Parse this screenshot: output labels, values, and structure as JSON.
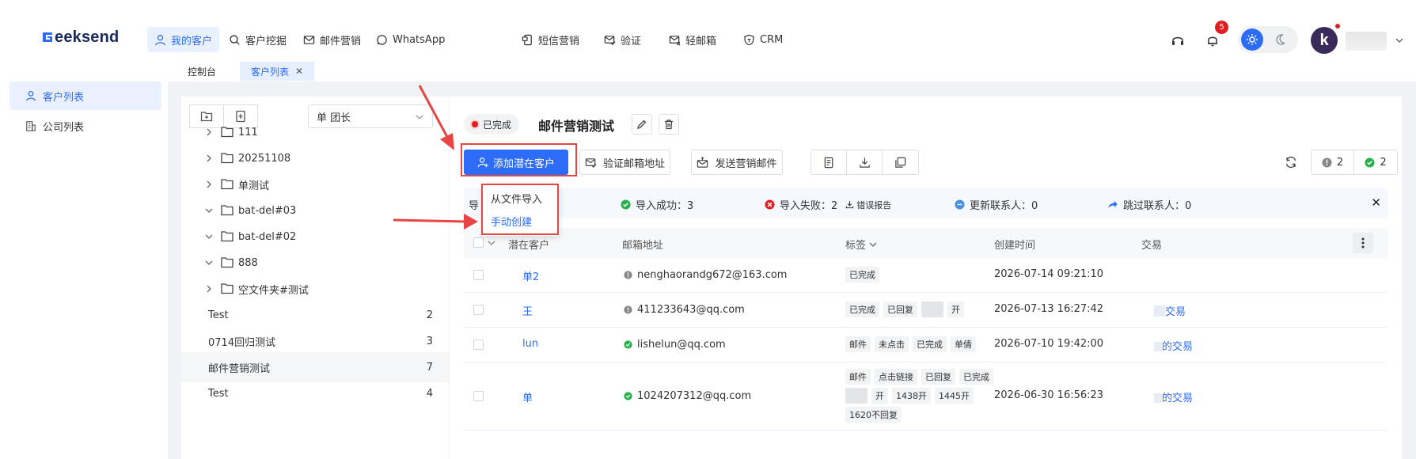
{
  "brand": {
    "logo_rest": "eeksend"
  },
  "nav": {
    "items": [
      {
        "label": "我的客户"
      },
      {
        "label": "客户挖掘"
      },
      {
        "label": "邮件营销"
      },
      {
        "label": "WhatsApp"
      },
      {
        "label": "短信营销"
      },
      {
        "label": "验证"
      },
      {
        "label": "轻邮箱"
      },
      {
        "label": "CRM"
      }
    ],
    "notification_count": "5"
  },
  "tabs": [
    {
      "label": "控制台"
    },
    {
      "label": "客户列表"
    }
  ],
  "sidebar": {
    "items": [
      {
        "label": "客户列表"
      },
      {
        "label": "公司列表"
      }
    ]
  },
  "folders": {
    "select_value": "单 团长",
    "items": [
      {
        "label": "111",
        "count": ""
      },
      {
        "label": "20251108",
        "count": ""
      },
      {
        "label": "单测试",
        "count": ""
      },
      {
        "label": "bat-del#03",
        "count": ""
      },
      {
        "label": "bat-del#02",
        "count": ""
      },
      {
        "label": "888",
        "count": ""
      },
      {
        "label": "空文件夹#测试",
        "count": ""
      },
      {
        "label": "Test",
        "count": "2"
      },
      {
        "label": "0714回归测试",
        "count": "3"
      },
      {
        "label": "邮件营销测试",
        "count": "7"
      },
      {
        "label": "Test",
        "count": "4"
      }
    ]
  },
  "main": {
    "status": "已完成",
    "title": "邮件营销测试",
    "add_button": "添加潜在客户",
    "verify_button": "验证邮箱地址",
    "send_button": "发送营销邮件",
    "count_warn": "2",
    "count_ok": "2"
  },
  "dropdown": {
    "from_file": "从文件导入",
    "manual": "手动创建"
  },
  "banner": {
    "prefix": "导",
    "success": "导入成功：3",
    "fail": "导入失败：2",
    "report": "错误报告",
    "update": "更新联系人：0",
    "skip": "跳过联系人：0"
  },
  "table": {
    "headers": {
      "prospect": "潜在客户",
      "email": "邮箱地址",
      "tags": "标签",
      "created": "创建时间",
      "deal": "交易"
    },
    "rows": [
      {
        "name": "单2",
        "email": "nenghaorandg672@163.com",
        "email_status": "unknown",
        "tags": [
          "已完成"
        ],
        "created": "2026-07-14 09:21:10",
        "deal": ""
      },
      {
        "name": "王",
        "email": "411233643@qq.com",
        "email_status": "unknown",
        "tags": [
          "已完成",
          "已回复",
          "",
          "开"
        ],
        "created": "2026-07-13 16:27:42",
        "deal": "交易"
      },
      {
        "name": "lun",
        "email": "lishelun@qq.com",
        "email_status": "valid",
        "tags": [
          "邮件",
          "未点击",
          "已完成",
          "单倩"
        ],
        "created": "2026-07-10 19:42:00",
        "deal": "的交易"
      },
      {
        "name": "单",
        "email": "1024207312@qq.com",
        "email_status": "valid",
        "tags": [
          "邮件",
          "点击链接",
          "已回复",
          "已完成",
          "",
          "开",
          "1438开",
          "1445开",
          "1620不回复"
        ],
        "created": "2026-06-30 16:56:23",
        "deal": "的交易"
      }
    ]
  },
  "colors": {
    "accent": "#2d6cf6",
    "highlight": "#e84545",
    "success": "#27b14a",
    "error": "#e02020"
  }
}
